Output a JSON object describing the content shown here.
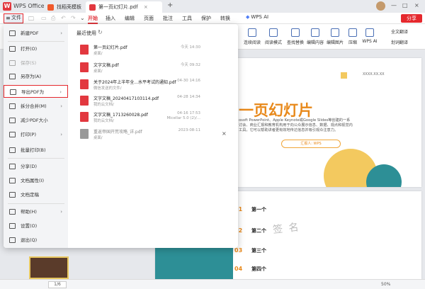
{
  "titlebar": {
    "app_name": "WPS Office",
    "tabs": [
      {
        "label": "找稻壳模板",
        "close": ""
      },
      {
        "label": "第一页幻灯片.pdf",
        "close": "×"
      }
    ],
    "new_tab": "+",
    "window_controls": [
      "—",
      "□",
      "×"
    ]
  },
  "menubar": {
    "file_label": "文件",
    "tabs": [
      "开始",
      "插入",
      "编辑",
      "页面",
      "批注",
      "工具",
      "保护",
      "转换"
    ],
    "active_tab": "开始",
    "wps_ai": "WPS AI",
    "share": "分享"
  },
  "ribbon": {
    "items": [
      "连续阅读",
      "阅读模式",
      "查找替换",
      "编辑内容",
      "编辑图片",
      "压缩",
      "WPS AI"
    ],
    "right_top": "全文翻译",
    "right_bottom": "划词翻译"
  },
  "backstage": {
    "menu": [
      {
        "label": "新建PDF",
        "chevron": "›",
        "disabled": false
      },
      {
        "label": "打开(O)",
        "chevron": "",
        "disabled": false
      },
      {
        "label": "保存(S)",
        "chevron": "",
        "disabled": true
      },
      {
        "label": "另存为(A)",
        "chevron": "",
        "disabled": false
      },
      {
        "label": "导出PDF为",
        "chevron": "›",
        "disabled": false
      },
      {
        "label": "拆分合并(M)",
        "chevron": "›",
        "disabled": false
      },
      {
        "label": "减少PDF大小",
        "chevron": "",
        "disabled": false
      },
      {
        "label": "打印(P)",
        "chevron": "›",
        "disabled": false
      },
      {
        "label": "批量打印(B)",
        "chevron": "",
        "disabled": false
      },
      {
        "label": "分享(D)",
        "chevron": "",
        "disabled": false
      },
      {
        "label": "文档属性(I)",
        "chevron": "",
        "disabled": false
      },
      {
        "label": "文档定稿",
        "chevron": "",
        "disabled": false
      },
      {
        "label": "帮助(H)",
        "chevron": "›",
        "disabled": false
      },
      {
        "label": "设置(O)",
        "chevron": "",
        "disabled": false
      },
      {
        "label": "退出(Q)",
        "chevron": "",
        "disabled": false
      }
    ],
    "recent_title": "最近使用",
    "recent": [
      {
        "name": "第一页幻灯片.pdf",
        "location": "桌面/",
        "date": "今天 14:30",
        "date2": ""
      },
      {
        "name": "文字文稿.pdf",
        "location": "桌面/",
        "date": "今天 09:32",
        "date2": ""
      },
      {
        "name": "关于2024年上半年全...水平考试的通知.pdf",
        "location": "微信发送的文件/",
        "date": "04-30 14:16",
        "date2": ""
      },
      {
        "name": "文字文稿_20240417103114.pdf",
        "location": "我的云文档/",
        "date": "04-28 14:34",
        "date2": ""
      },
      {
        "name": "文字文稿_1713260028.pdf",
        "location": "我的云文档/",
        "date": "04-16 17:53",
        "date2": "Micellar 5.0 (2)/..."
      },
      {
        "name": "重返帝国开荒攻略_详.pdf",
        "location": "桌面/",
        "date": "2023-08-11",
        "date2": ""
      }
    ],
    "close": "×"
  },
  "document": {
    "slide_title": "一页幻灯片",
    "date_tag": "XXXX.XX.XX",
    "subtitle_lines": [
      "osoft PowerPoint、Apple Keynote或Google Slides等创建的一系",
      "讨会、商业汇报和教育机构用于向公众展示信息、数据、观点和视觉内",
      "工具，它可以帮助讲者更有效地传达信息并吸引观众注意力。"
    ],
    "reporter": "汇报人: WPS",
    "outline": [
      {
        "num": "01",
        "text": "第一个"
      },
      {
        "num": "02",
        "text": "第二个"
      },
      {
        "num": "03",
        "text": "第三个"
      },
      {
        "num": "04",
        "text": "第四个"
      }
    ],
    "signature": "签 名"
  },
  "statusbar": {
    "page": "1/6",
    "zoom": "50%"
  }
}
